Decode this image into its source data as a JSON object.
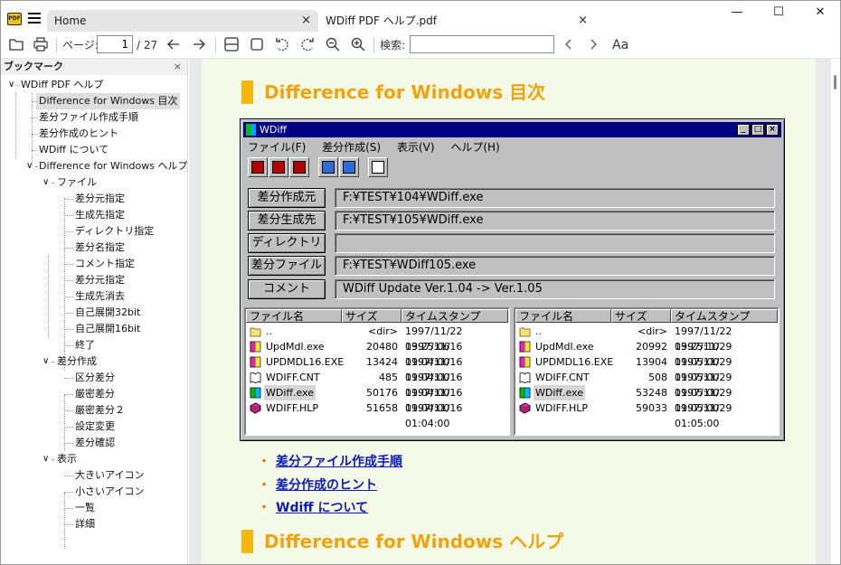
{
  "tabs": [
    {
      "label": "Home",
      "close": "×"
    },
    {
      "label": "WDiff  PDF ヘルプ.pdf",
      "close": "×"
    }
  ],
  "window_controls": {
    "minimize": "—",
    "maximize": "☐",
    "close": "✕"
  },
  "toolbar": {
    "page_label": "ページ:",
    "page_value": "1",
    "page_total": "/ 27",
    "search_label": "検索:",
    "search_value": "",
    "font_glyph": "Aa"
  },
  "sidebar": {
    "title": "ブックマーク",
    "close": "×",
    "nodes": [
      {
        "label": "WDiff PDF ヘルプ",
        "level": 0,
        "toggle": "∨"
      },
      {
        "label": "Difference for Windows 目次",
        "level": 1,
        "selected": true
      },
      {
        "label": "差分ファイル作成手順",
        "level": 1
      },
      {
        "label": "差分作成のヒント",
        "level": 1
      },
      {
        "label": "WDiff について",
        "level": 1
      },
      {
        "label": "Difference for Windows ヘルプ",
        "level": 1,
        "toggle": "∨"
      },
      {
        "label": "ファイル",
        "level": 2,
        "toggle": "∨"
      },
      {
        "label": "差分元指定",
        "level": 3
      },
      {
        "label": "生成先指定",
        "level": 3
      },
      {
        "label": "ディレクトリ指定",
        "level": 3
      },
      {
        "label": "差分名指定",
        "level": 3
      },
      {
        "label": "コメント指定",
        "level": 3
      },
      {
        "label": "差分元指定",
        "level": 3
      },
      {
        "label": "生成先消去",
        "level": 3
      },
      {
        "label": "自己展開32bit",
        "level": 3
      },
      {
        "label": "自己展開16bit",
        "level": 3
      },
      {
        "label": "終了",
        "level": 3
      },
      {
        "label": "差分作成",
        "level": 2,
        "toggle": "∨"
      },
      {
        "label": "区分差分",
        "level": 3
      },
      {
        "label": "厳密差分",
        "level": 3
      },
      {
        "label": "厳密差分２",
        "level": 3
      },
      {
        "label": "設定変更",
        "level": 3
      },
      {
        "label": "差分確認",
        "level": 3
      },
      {
        "label": "表示",
        "level": 2,
        "toggle": "∨"
      },
      {
        "label": "大きいアイコン",
        "level": 3
      },
      {
        "label": "小さいアイコン",
        "level": 3
      },
      {
        "label": "一覧",
        "level": 3
      },
      {
        "label": "詳細",
        "level": 3
      }
    ]
  },
  "document": {
    "heading1": "Difference for Windows 目次",
    "links": [
      "差分ファイル作成手順",
      "差分作成のヒント",
      "Wdiff について"
    ],
    "heading2": "Difference for Windows ヘルプ",
    "bullet": "・",
    "accent": "#f7b80b",
    "link_color": "#0a1ab8"
  },
  "wdiff_window": {
    "title": "WDiff",
    "menu": [
      "ファイル(F)",
      "差分作成(S)",
      "表示(V)",
      "ヘルプ(H)"
    ],
    "rows": [
      {
        "button": "差分作成元",
        "value": "F:¥TEST¥104¥WDiff.exe"
      },
      {
        "button": "差分生成先",
        "value": "F:¥TEST¥105¥WDiff.exe"
      },
      {
        "button": "ディレクトリ",
        "value": ""
      },
      {
        "button": "差分ファイル",
        "value": "F:¥TEST¥WDiff105.exe"
      },
      {
        "button": "コメント",
        "value": "WDiff Update Ver.1.04 -> Ver.1.05"
      }
    ],
    "columns": [
      "ファイル名",
      "サイズ",
      "タイムスタンプ"
    ],
    "left_list": [
      {
        "name": "..",
        "size": "<dir>",
        "time": "1997/11/22 03:25:06",
        "icon": "folder-icon"
      },
      {
        "name": "UpdMdl.exe",
        "size": "20480",
        "time": "1997/11/16 01:04:00",
        "icon": "exe-icon"
      },
      {
        "name": "UPDMDL16.EXE",
        "size": "13424",
        "time": "1997/11/16 01:04:00",
        "icon": "exe-icon"
      },
      {
        "name": "WDIFF.CNT",
        "size": "485",
        "time": "1997/11/16 01:04:00",
        "icon": "book-icon"
      },
      {
        "name": "WDiff.exe",
        "size": "50176",
        "time": "1997/11/16 01:04:00",
        "icon": "app-icon",
        "selected": true
      },
      {
        "name": "WDIFF.HLP",
        "size": "51658",
        "time": "1997/11/16 01:04:00",
        "icon": "help-book-icon"
      }
    ],
    "right_list": [
      {
        "name": "..",
        "size": "<dir>",
        "time": "1997/11/22 03:25:10",
        "icon": "folder-icon"
      },
      {
        "name": "UpdMdl.exe",
        "size": "20992",
        "time": "1997/11/29 01:05:00",
        "icon": "exe-icon"
      },
      {
        "name": "UPDMDL16.EXE",
        "size": "13904",
        "time": "1997/11/29 01:05:00",
        "icon": "exe-icon"
      },
      {
        "name": "WDIFF.CNT",
        "size": "508",
        "time": "1997/11/29 01:05:00",
        "icon": "book-icon"
      },
      {
        "name": "WDiff.exe",
        "size": "53248",
        "time": "1997/11/29 01:05:00",
        "icon": "app-icon",
        "selected": true
      },
      {
        "name": "WDIFF.HLP",
        "size": "59033",
        "time": "1997/11/29 01:05:00",
        "icon": "help-book-icon"
      }
    ]
  }
}
